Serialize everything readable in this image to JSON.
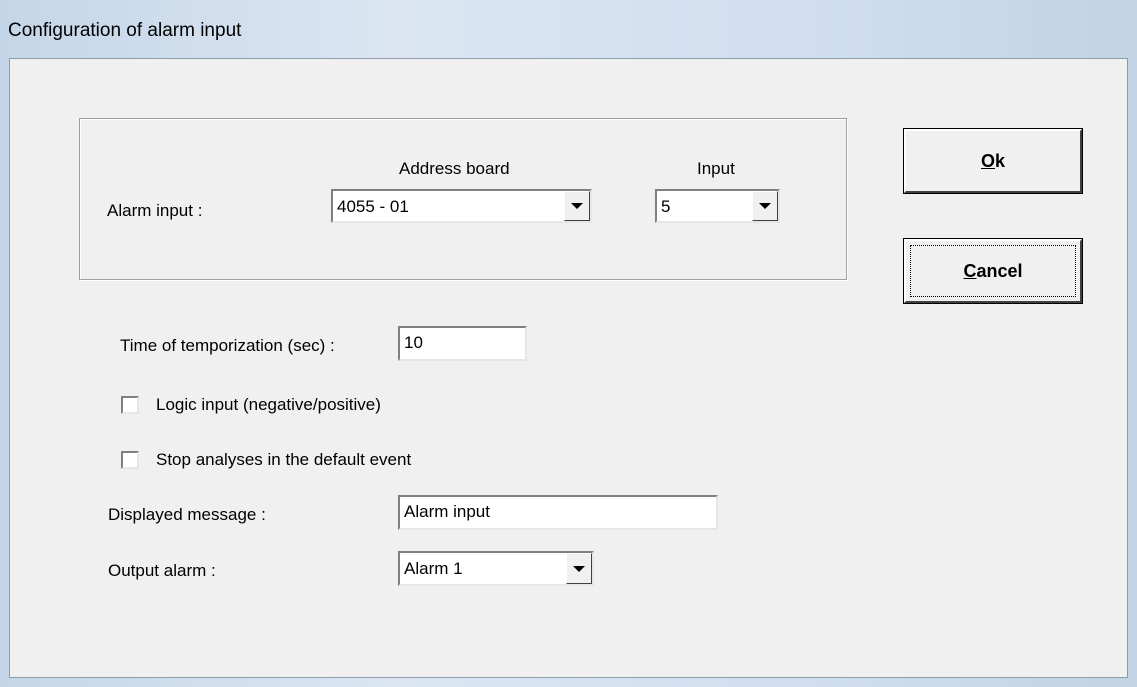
{
  "window": {
    "title": "Configuration of alarm input"
  },
  "alarm_group": {
    "row_label": "Alarm input :",
    "address_board": {
      "header": "Address board",
      "value": "4055 - 01"
    },
    "input": {
      "header": "Input",
      "value": "5"
    }
  },
  "buttons": {
    "ok": {
      "mnemonic": "O",
      "rest": "k"
    },
    "cancel": {
      "mnemonic": "C",
      "rest": "ancel"
    }
  },
  "temporization": {
    "label": "Time of temporization (sec) :",
    "value": "10"
  },
  "checkboxes": [
    {
      "label": "Logic input (negative/positive)",
      "checked": false
    },
    {
      "label": "Stop analyses in the default event",
      "checked": false
    }
  ],
  "displayed_message": {
    "label": "Displayed message :",
    "value": "Alarm input"
  },
  "output_alarm": {
    "label": "Output alarm :",
    "value": "Alarm 1"
  }
}
